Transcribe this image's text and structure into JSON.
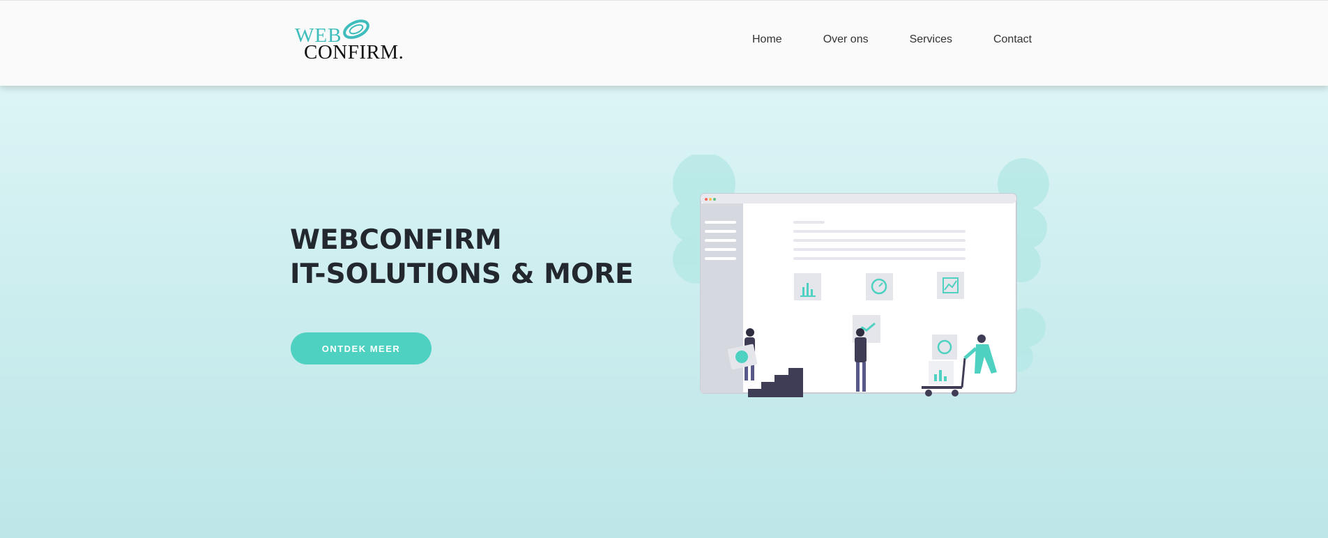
{
  "brand": {
    "logo_line1": "WEB",
    "logo_line2": "CONFIRM."
  },
  "nav": {
    "items": [
      "Home",
      "Over ons",
      "Services",
      "Contact"
    ]
  },
  "hero": {
    "title_line1": "WEBCONFIRM",
    "title_line2": "IT-SOLUTIONS & MORE",
    "cta_label": "ONTDEK MEER"
  },
  "colors": {
    "accent": "#4fd1c2",
    "logo_teal": "#3fbcbc",
    "heading": "#23282e",
    "header_bg": "#fafafa"
  },
  "illustration": {
    "icons": [
      "bar-chart-icon",
      "gauge-icon",
      "line-chart-icon"
    ],
    "figures": [
      "person-carrying-chart",
      "person-holding-chart",
      "person-pushing-cart"
    ]
  }
}
